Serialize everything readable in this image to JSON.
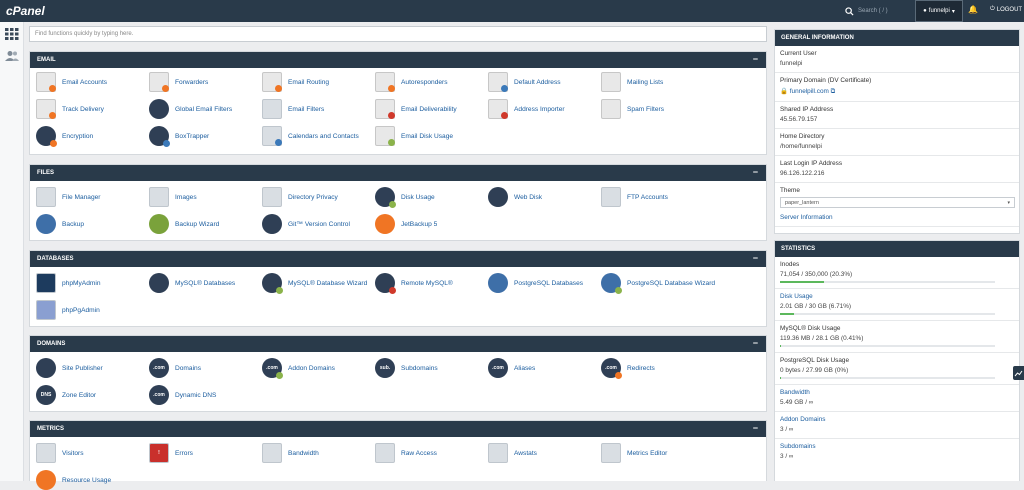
{
  "topbar": {
    "logo": "cPanel",
    "search_placeholder": "Search ( / )",
    "username": "funnelpi",
    "logout": "LOGOUT"
  },
  "finder": {
    "placeholder": "Find functions quickly by typing here."
  },
  "sections": {
    "email": {
      "title": "EMAIL",
      "items": [
        "Email Accounts",
        "Forwarders",
        "Email Routing",
        "Autoresponders",
        "Default Address",
        "Mailing Lists",
        "Track Delivery",
        "Global Email Filters",
        "Email Filters",
        "Email Deliverability",
        "Address Importer",
        "Spam Filters",
        "Encryption",
        "BoxTrapper",
        "Calendars and Contacts",
        "Email Disk Usage"
      ]
    },
    "files": {
      "title": "FILES",
      "items": [
        "File Manager",
        "Images",
        "Directory Privacy",
        "Disk Usage",
        "Web Disk",
        "FTP Accounts",
        "Backup",
        "Backup Wizard",
        "Git™ Version Control",
        "JetBackup 5"
      ]
    },
    "databases": {
      "title": "DATABASES",
      "items": [
        "phpMyAdmin",
        "MySQL® Databases",
        "MySQL® Database Wizard",
        "Remote MySQL®",
        "PostgreSQL Databases",
        "PostgreSQL Database Wizard",
        "phpPgAdmin"
      ]
    },
    "domains": {
      "title": "DOMAINS",
      "items": [
        "Site Publisher",
        "Domains",
        "Addon Domains",
        "Subdomains",
        "Aliases",
        "Redirects",
        "Zone Editor",
        "Dynamic DNS"
      ]
    },
    "metrics": {
      "title": "METRICS",
      "items": [
        "Visitors",
        "Errors",
        "Bandwidth",
        "Raw Access",
        "Awstats",
        "Metrics Editor",
        "Resource Usage"
      ]
    }
  },
  "general": {
    "title": "GENERAL INFORMATION",
    "current_user_label": "Current User",
    "current_user": "funnelpi",
    "primary_domain_label": "Primary Domain (DV Certificate)",
    "primary_domain": "funnelpill.com",
    "shared_ip_label": "Shared IP Address",
    "shared_ip": "45.56.79.157",
    "home_dir_label": "Home Directory",
    "home_dir": "/home/funnelpi",
    "last_login_label": "Last Login IP Address",
    "last_login": "96.126.122.216",
    "theme_label": "Theme",
    "theme": "paper_lantern",
    "server_info": "Server Information"
  },
  "statistics": {
    "title": "STATISTICS",
    "inodes_label": "Inodes",
    "inodes": "71,054 / 350,000   (20.3%)",
    "inodes_pct": 20.3,
    "disk_label": "Disk Usage",
    "disk": "2.01 GB / 30 GB   (6.71%)",
    "disk_pct": 6.71,
    "mysql_label": "MySQL® Disk Usage",
    "mysql": "119.36 MB / 28.1 GB   (0.41%)",
    "mysql_pct": 0.41,
    "pg_label": "PostgreSQL Disk Usage",
    "pg": "0 bytes / 27.99 GB   (0%)",
    "pg_pct": 0,
    "bandwidth_label": "Bandwidth",
    "bandwidth": "5.49 GB / ∞",
    "addon_label": "Addon Domains",
    "addon": "3 / ∞",
    "sub_label": "Subdomains",
    "sub": "3 / ∞"
  },
  "colors": {
    "header": "#293a4a",
    "link": "#1a5c9e",
    "bar": "#5cb85c"
  }
}
